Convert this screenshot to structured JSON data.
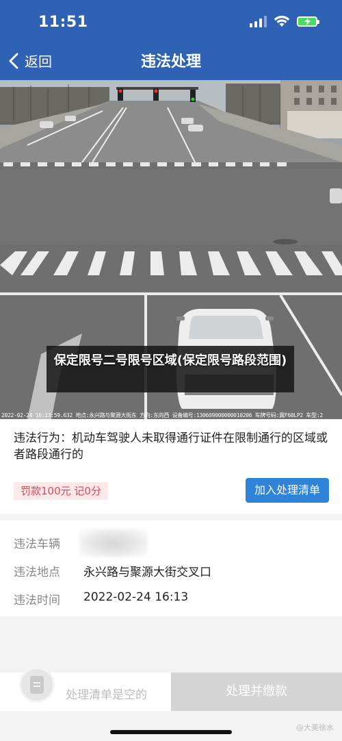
{
  "status_bar": {
    "time": "11:51"
  },
  "nav": {
    "back_label": "返回",
    "title": "违法处理"
  },
  "photo": {
    "overlay_title": "保定限号二号限号区域(保定限号路段范围)",
    "caption": "2022-02-24 16:13:59.632  地点:永兴路与聚源大街东  方向:东向西  设备编号:130609000000010206  车牌号码:冀F60LP2  车型:2"
  },
  "violation": {
    "behavior": "违法行为：机动车驾驶人未取得通行证件在限制通行的区域或者路段通行的",
    "fine": "罚款100元  记0分",
    "add_button": "加入处理清单"
  },
  "details": {
    "vehicle_label": "违法车辆",
    "location_label": "违法地点",
    "location_value": "永兴路与聚源大街交叉口",
    "time_label": "违法时间",
    "time_value": "2022-02-24 16:13"
  },
  "bottom": {
    "empty_text": "处理清单是空的",
    "pay_button": "处理并缴款"
  },
  "watermark": "@大美徐水",
  "icons": {
    "back": "chevron-left-icon",
    "signal": "cellular-signal-icon",
    "wifi": "wifi-icon",
    "battery": "battery-charging-icon",
    "list": "list-icon"
  },
  "colors": {
    "nav_blue": "#2f62b5",
    "button_blue": "#2f83d9",
    "fine_red": "#e3454f",
    "fine_bg": "#fde8ea",
    "disabled_gray": "#d4d4d4"
  }
}
